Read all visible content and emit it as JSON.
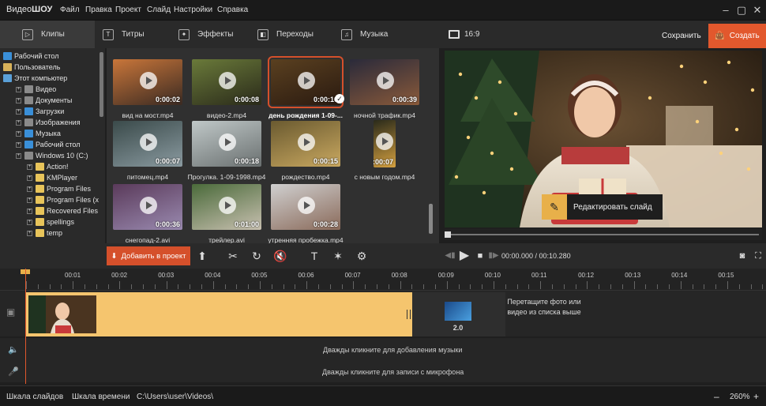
{
  "app": {
    "logo_a": "Видео",
    "logo_b": "ШОУ"
  },
  "menu": [
    "Файл",
    "Правка",
    "Проект",
    "Слайд",
    "Настройки",
    "Справка"
  ],
  "tabs": [
    "Клипы",
    "Титры",
    "Эффекты",
    "Переходы",
    "Музыка"
  ],
  "tree": [
    {
      "label": "Рабочий стол",
      "icon": "desktop-icon",
      "color": "#3a8fd8"
    },
    {
      "label": "Пользователь",
      "icon": "user-icon",
      "color": "#d8b25a"
    },
    {
      "label": "Этот компьютер",
      "icon": "computer-icon",
      "color": "#5aa0d8"
    },
    {
      "label": "Видео",
      "icon": "video-folder-icon",
      "color": "#8a8a8a"
    },
    {
      "label": "Документы",
      "icon": "documents-icon",
      "color": "#8a8a8a"
    },
    {
      "label": "Загрузки",
      "icon": "downloads-icon",
      "color": "#3a8fd8"
    },
    {
      "label": "Изображения",
      "icon": "images-icon",
      "color": "#8a8a8a"
    },
    {
      "label": "Музыка",
      "icon": "music-icon",
      "color": "#3a8fd8"
    },
    {
      "label": "Рабочий стол",
      "icon": "desktop-icon",
      "color": "#3a8fd8"
    },
    {
      "label": "Windows 10 (C:)",
      "icon": "drive-icon",
      "color": "#8a8a8a"
    },
    {
      "label": "Action!",
      "icon": "folder-icon",
      "color": "#e8c45a"
    },
    {
      "label": "KMPlayer",
      "icon": "folder-icon",
      "color": "#e8c45a"
    },
    {
      "label": "Program Files",
      "icon": "folder-icon",
      "color": "#e8c45a"
    },
    {
      "label": "Program Files (x",
      "icon": "folder-icon",
      "color": "#e8c45a"
    },
    {
      "label": "Recovered Files",
      "icon": "folder-icon",
      "color": "#e8c45a"
    },
    {
      "label": "spellings",
      "icon": "folder-icon",
      "color": "#e8c45a"
    },
    {
      "label": "temp",
      "icon": "folder-icon",
      "color": "#e8c45a"
    }
  ],
  "clips": [
    {
      "name": "вид на мост.mp4",
      "dur": "0:00:02"
    },
    {
      "name": "видео-2.mp4",
      "dur": "0:00:08"
    },
    {
      "name": "день рождения 1-09-...",
      "dur": "0:00:10"
    },
    {
      "name": "ночной трафик.mp4",
      "dur": "0:00:39"
    },
    {
      "name": "питомец.mp4",
      "dur": "0:00:07"
    },
    {
      "name": "Прогулка. 1-09-1998.mp4",
      "dur": "0:00:18"
    },
    {
      "name": "рождество.mp4",
      "dur": "0:00:15"
    },
    {
      "name": "с новым годом.mp4",
      "dur": "0:00:07"
    },
    {
      "name": "снегопад-2.avi",
      "dur": "0:00:36"
    },
    {
      "name": "трейлер.avi",
      "dur": "0:01:00"
    },
    {
      "name": "утренняя пробежка.mp4",
      "dur": "0:00:28"
    }
  ],
  "preview": {
    "ratio": "16:9",
    "save": "Сохранить",
    "create": "Создать",
    "edit_slide": "Редактировать слайд"
  },
  "toolbar": {
    "add": "Добавить в проект"
  },
  "player": {
    "time": "00:00.000 / 00:10.280"
  },
  "ruler": [
    "00:01",
    "00:02",
    "00:03",
    "00:04",
    "00:05",
    "00:06",
    "00:07",
    "00:08",
    "00:09",
    "00:10",
    "00:11",
    "00:12",
    "00:13",
    "00:14",
    "00:15"
  ],
  "timeline": {
    "transition_dur": "2.0",
    "hint": "Перетащите фото или видео из списка выше",
    "music": "Дважды кликните для добавления музыки",
    "mic": "Дважды кликните для записи с микрофона"
  },
  "status": {
    "slides": "Шкала слайдов",
    "time": "Шкала времени",
    "path": "C:\\Users\\user\\Videos\\",
    "zoom": "260%"
  }
}
